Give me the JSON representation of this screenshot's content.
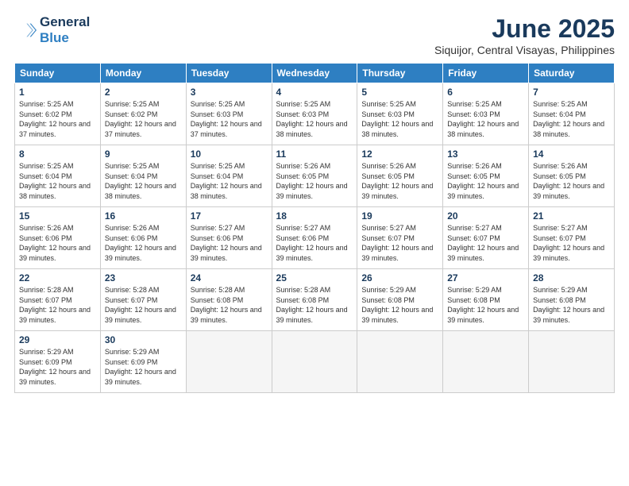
{
  "logo": {
    "line1": "General",
    "line2": "Blue"
  },
  "title": "June 2025",
  "location": "Siquijor, Central Visayas, Philippines",
  "headers": [
    "Sunday",
    "Monday",
    "Tuesday",
    "Wednesday",
    "Thursday",
    "Friday",
    "Saturday"
  ],
  "weeks": [
    [
      {
        "day": "1",
        "sunrise": "5:25 AM",
        "sunset": "6:02 PM",
        "daylight": "12 hours and 37 minutes."
      },
      {
        "day": "2",
        "sunrise": "5:25 AM",
        "sunset": "6:02 PM",
        "daylight": "12 hours and 37 minutes."
      },
      {
        "day": "3",
        "sunrise": "5:25 AM",
        "sunset": "6:03 PM",
        "daylight": "12 hours and 37 minutes."
      },
      {
        "day": "4",
        "sunrise": "5:25 AM",
        "sunset": "6:03 PM",
        "daylight": "12 hours and 38 minutes."
      },
      {
        "day": "5",
        "sunrise": "5:25 AM",
        "sunset": "6:03 PM",
        "daylight": "12 hours and 38 minutes."
      },
      {
        "day": "6",
        "sunrise": "5:25 AM",
        "sunset": "6:03 PM",
        "daylight": "12 hours and 38 minutes."
      },
      {
        "day": "7",
        "sunrise": "5:25 AM",
        "sunset": "6:04 PM",
        "daylight": "12 hours and 38 minutes."
      }
    ],
    [
      {
        "day": "8",
        "sunrise": "5:25 AM",
        "sunset": "6:04 PM",
        "daylight": "12 hours and 38 minutes."
      },
      {
        "day": "9",
        "sunrise": "5:25 AM",
        "sunset": "6:04 PM",
        "daylight": "12 hours and 38 minutes."
      },
      {
        "day": "10",
        "sunrise": "5:25 AM",
        "sunset": "6:04 PM",
        "daylight": "12 hours and 38 minutes."
      },
      {
        "day": "11",
        "sunrise": "5:26 AM",
        "sunset": "6:05 PM",
        "daylight": "12 hours and 39 minutes."
      },
      {
        "day": "12",
        "sunrise": "5:26 AM",
        "sunset": "6:05 PM",
        "daylight": "12 hours and 39 minutes."
      },
      {
        "day": "13",
        "sunrise": "5:26 AM",
        "sunset": "6:05 PM",
        "daylight": "12 hours and 39 minutes."
      },
      {
        "day": "14",
        "sunrise": "5:26 AM",
        "sunset": "6:05 PM",
        "daylight": "12 hours and 39 minutes."
      }
    ],
    [
      {
        "day": "15",
        "sunrise": "5:26 AM",
        "sunset": "6:06 PM",
        "daylight": "12 hours and 39 minutes."
      },
      {
        "day": "16",
        "sunrise": "5:26 AM",
        "sunset": "6:06 PM",
        "daylight": "12 hours and 39 minutes."
      },
      {
        "day": "17",
        "sunrise": "5:27 AM",
        "sunset": "6:06 PM",
        "daylight": "12 hours and 39 minutes."
      },
      {
        "day": "18",
        "sunrise": "5:27 AM",
        "sunset": "6:06 PM",
        "daylight": "12 hours and 39 minutes."
      },
      {
        "day": "19",
        "sunrise": "5:27 AM",
        "sunset": "6:07 PM",
        "daylight": "12 hours and 39 minutes."
      },
      {
        "day": "20",
        "sunrise": "5:27 AM",
        "sunset": "6:07 PM",
        "daylight": "12 hours and 39 minutes."
      },
      {
        "day": "21",
        "sunrise": "5:27 AM",
        "sunset": "6:07 PM",
        "daylight": "12 hours and 39 minutes."
      }
    ],
    [
      {
        "day": "22",
        "sunrise": "5:28 AM",
        "sunset": "6:07 PM",
        "daylight": "12 hours and 39 minutes."
      },
      {
        "day": "23",
        "sunrise": "5:28 AM",
        "sunset": "6:07 PM",
        "daylight": "12 hours and 39 minutes."
      },
      {
        "day": "24",
        "sunrise": "5:28 AM",
        "sunset": "6:08 PM",
        "daylight": "12 hours and 39 minutes."
      },
      {
        "day": "25",
        "sunrise": "5:28 AM",
        "sunset": "6:08 PM",
        "daylight": "12 hours and 39 minutes."
      },
      {
        "day": "26",
        "sunrise": "5:29 AM",
        "sunset": "6:08 PM",
        "daylight": "12 hours and 39 minutes."
      },
      {
        "day": "27",
        "sunrise": "5:29 AM",
        "sunset": "6:08 PM",
        "daylight": "12 hours and 39 minutes."
      },
      {
        "day": "28",
        "sunrise": "5:29 AM",
        "sunset": "6:08 PM",
        "daylight": "12 hours and 39 minutes."
      }
    ],
    [
      {
        "day": "29",
        "sunrise": "5:29 AM",
        "sunset": "6:09 PM",
        "daylight": "12 hours and 39 minutes."
      },
      {
        "day": "30",
        "sunrise": "5:29 AM",
        "sunset": "6:09 PM",
        "daylight": "12 hours and 39 minutes."
      },
      null,
      null,
      null,
      null,
      null
    ]
  ]
}
